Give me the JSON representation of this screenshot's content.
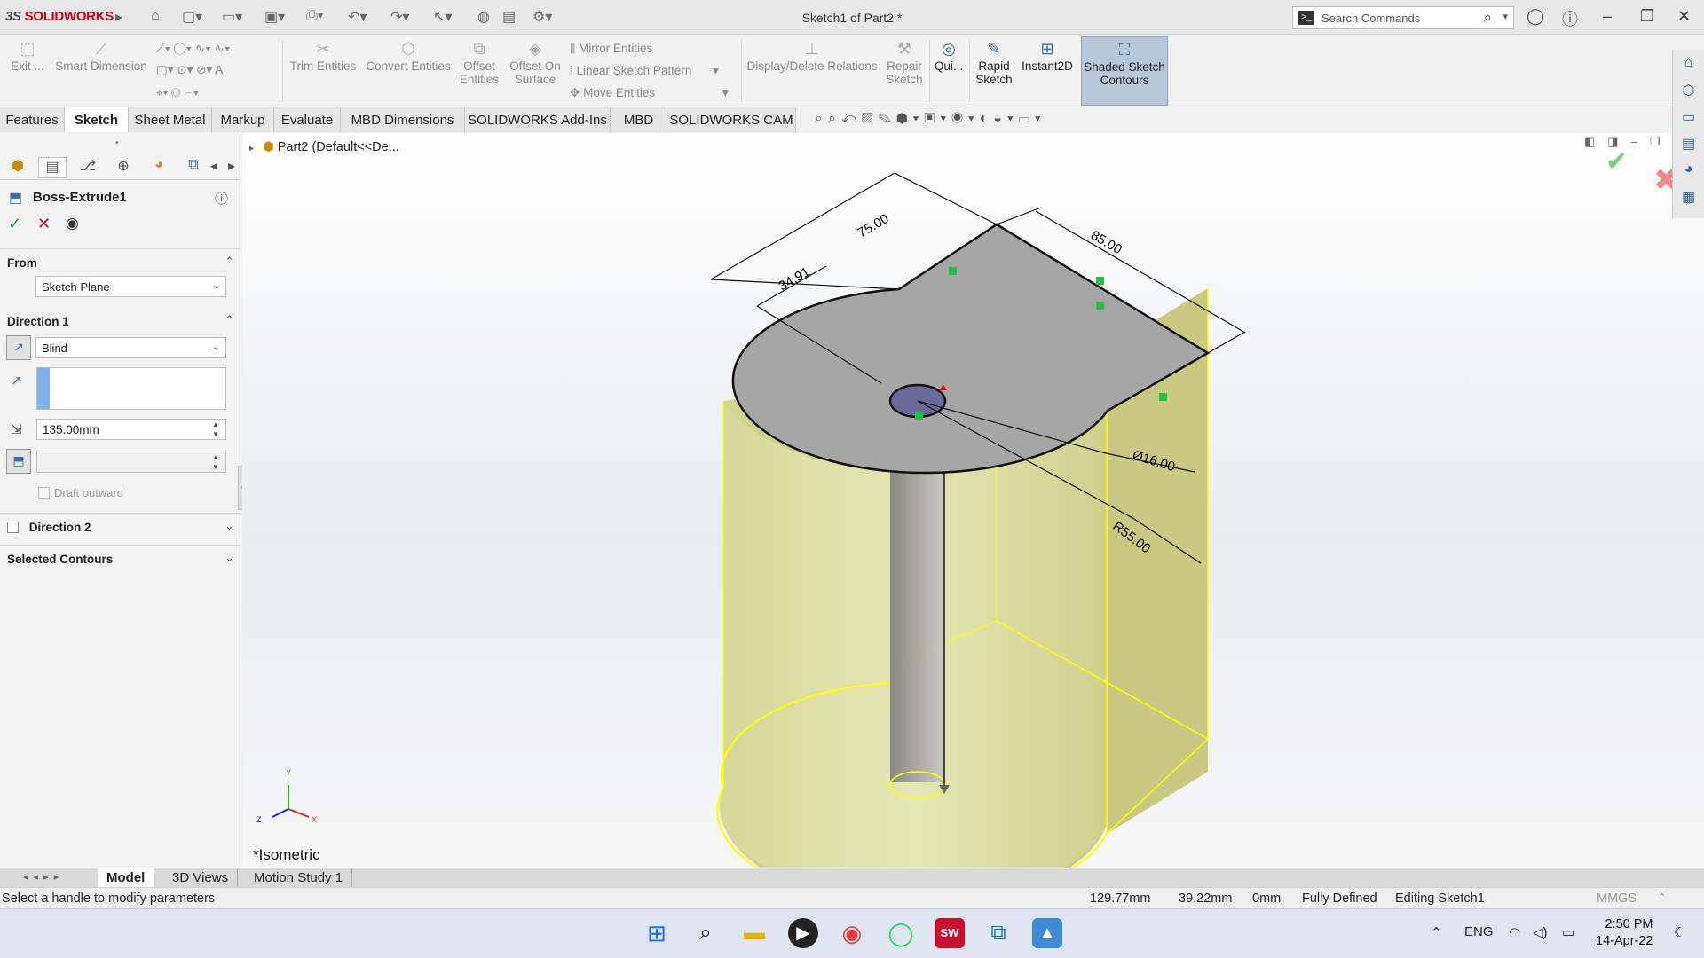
{
  "app": {
    "brand_ds": "3S",
    "brand_name": "SOLIDWORKS",
    "doc_title": "Sketch1 of Part2 *"
  },
  "search": {
    "placeholder": "Search Commands",
    "icon": "terminal-icon"
  },
  "ribbon": {
    "exit": "Exit ...",
    "smart_dimension": "Smart Dimension",
    "trim_entities": "Trim Entities",
    "convert_entities": "Convert Entities",
    "offset_entities_1": "Offset",
    "offset_entities_2": "Entities",
    "offset_on_surface_1": "Offset On",
    "offset_on_surface_2": "Surface",
    "mirror_entities": "Mirror Entities",
    "linear_sketch_pattern": "Linear Sketch Pattern",
    "move_entities": "Move Entities",
    "display_delete_relations": "Display/Delete Relations",
    "repair_sketch_1": "Repair",
    "repair_sketch_2": "Sketch",
    "quick_snaps": "Qui...",
    "rapid_sketch_1": "Rapid",
    "rapid_sketch_2": "Sketch",
    "instant2d": "Instant2D",
    "shaded_contours_1": "Shaded Sketch",
    "shaded_contours_2": "Contours"
  },
  "tabs": [
    "Features",
    "Sketch",
    "Sheet Metal",
    "Markup",
    "Evaluate",
    "MBD Dimensions",
    "SOLIDWORKS Add-Ins",
    "MBD",
    "SOLIDWORKS CAM"
  ],
  "tree": {
    "part": "Part2",
    "config": "(Default<<De..."
  },
  "feature": {
    "title": "Boss-Extrude1",
    "from_label": "From",
    "from_value": "Sketch Plane",
    "direction1_label": "Direction 1",
    "end_condition": "Blind",
    "depth": "135.00mm",
    "draft_label": "Draft outward",
    "direction2_label": "Direction 2",
    "selected_contours_label": "Selected Contours"
  },
  "dimensions": {
    "d1": "75.00",
    "d2": "34.91",
    "d3": "85.00",
    "d4": "Ø16.00",
    "d5": "R55.00"
  },
  "triad": {
    "x": "X",
    "y": "Y",
    "z": "Z"
  },
  "view": {
    "orientation": "*Isometric"
  },
  "bottom_tabs": [
    "Model",
    "3D Views",
    "Motion Study 1"
  ],
  "status": {
    "message": "Select a handle to modify parameters",
    "x": "129.77mm",
    "y": "39.22mm",
    "z": "0mm",
    "definition": "Fully Defined",
    "mode": "Editing Sketch1",
    "units": "MMGS"
  },
  "taskbar": {
    "lang": "ENG",
    "time": "2:50 PM",
    "date": "14-Apr-22"
  },
  "colors": {
    "accent": "#d0021b",
    "body": "#d9d98a",
    "face": "#a6a6a6",
    "handle": "#22c04a"
  }
}
